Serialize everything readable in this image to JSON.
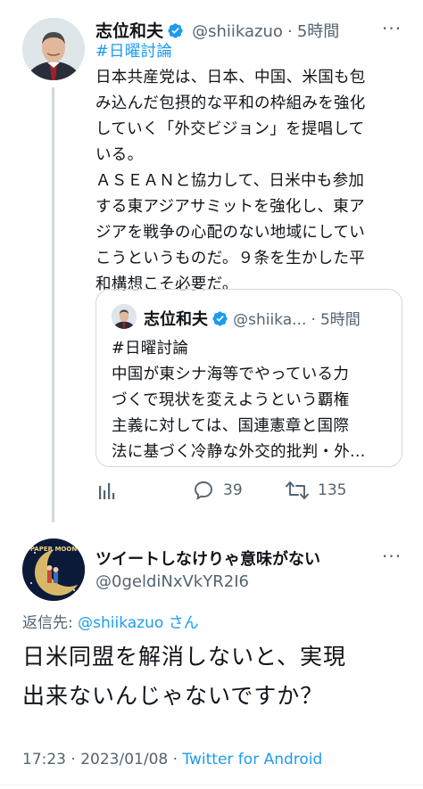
{
  "parent_tweet": {
    "display_name": "志位和夫",
    "handle": "@shiikazuo",
    "time": "5時間",
    "hashtag": "#日曜討論",
    "lines": [
      "日本共産党は、日本、中国、米国も包",
      "み込んだ包摂的な平和の枠組みを強化",
      "していく「外交ビジョン」を提唱して",
      "いる。",
      "ＡＳＥＡＮと協力して、日米中も参加",
      "する東アジアサミットを強化し、東ア",
      "ジアを戦争の心配のない地域にしてい",
      "こうというものだ。９条を生かした平",
      "和構想こそ必要だ。"
    ],
    "quote": {
      "display_name": "志位和夫",
      "handle": "@shiika...",
      "time": "5時間",
      "hashtag": "#日曜討論",
      "lines": [
        "中国が東シナ海等でやっている力",
        "づくで現状を変えようという覇権",
        "主義に対しては、国連憲章と国際",
        "法に基づく冷静な外交的批判・外..."
      ]
    },
    "actions": {
      "replies": "39",
      "retweets": "135"
    }
  },
  "reply_tweet": {
    "display_name": "ツイートしなけりゃ意味がない",
    "handle": "@0geldiNxVkYR2I6",
    "avatar_text": "PAPER MOON",
    "replying_to_prefix": "返信先:",
    "replying_to_handle": "@shiikazuo",
    "replying_to_suffix": "さん",
    "lines": [
      "日米同盟を解消しないと、実現",
      "出来ないんじゃないですか？"
    ],
    "time": "17:23",
    "date": "2023/01/08",
    "client": "Twitter for Android"
  },
  "colors": {
    "accent": "#1d9bf0",
    "secondary_text": "#536471",
    "border": "#cfd9de"
  }
}
